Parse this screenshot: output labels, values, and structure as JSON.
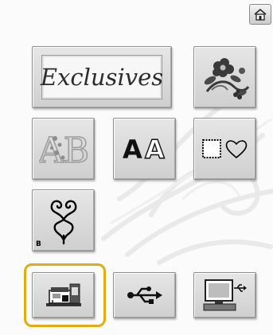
{
  "header": {
    "home_icon": "home-icon"
  },
  "exclusives": {
    "label": "Exclusives"
  },
  "tiles": {
    "floral_design": "flower-design-icon",
    "alphabet_floral": "AB",
    "font_pattern": "AA",
    "frame_pattern": "frame-heart-icon",
    "monogram_label": "B",
    "monogram": "heart-monogram-icon",
    "machine_memory": "sewing-machine-icon",
    "usb_media": "usb-icon",
    "computer": "computer-usb-icon"
  },
  "selected": "machine-memory-button",
  "colors": {
    "highlight": "#e0ad10",
    "tile": "#d6d6d6"
  }
}
